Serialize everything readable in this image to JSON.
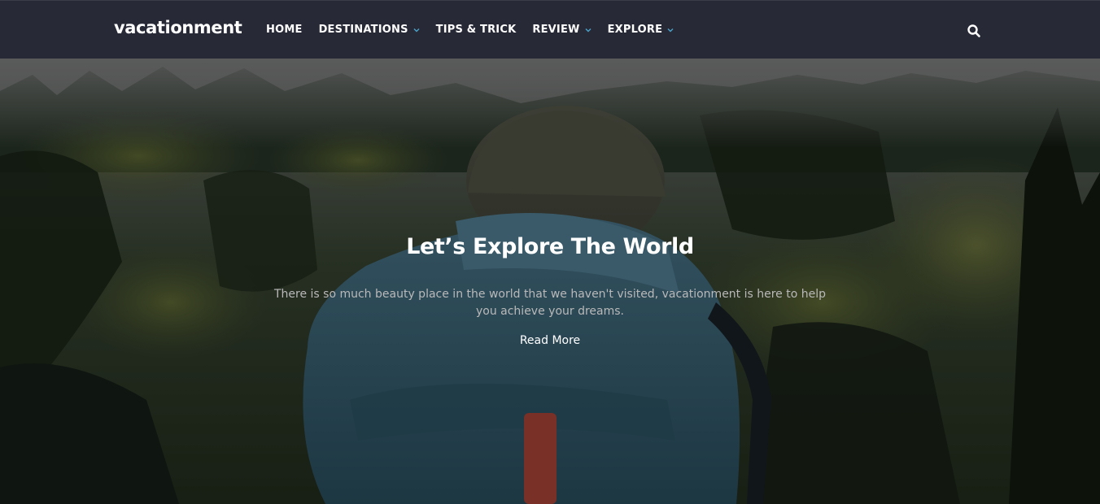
{
  "brand": {
    "name": "vacationment"
  },
  "nav": {
    "items": [
      {
        "label": "HOME",
        "dropdown": false
      },
      {
        "label": "DESTINATIONS",
        "dropdown": true
      },
      {
        "label": "TIPS & TRICK",
        "dropdown": false
      },
      {
        "label": "REVIEW",
        "dropdown": true
      },
      {
        "label": "EXPLORE",
        "dropdown": true
      }
    ],
    "search_icon": "search-icon",
    "chevron_icon": "chevron-down-icon"
  },
  "hero": {
    "title": "Let’s Explore The World",
    "description": "There is so much beauty place in the world that we haven't visited, vacationment is here to help you achieve your dreams.",
    "cta_label": "Read More"
  },
  "colors": {
    "navbar_bg": "#272937",
    "accent_chevron": "#4aa3c9",
    "text_white": "#ffffff",
    "text_muted": "#b9b9b9"
  }
}
